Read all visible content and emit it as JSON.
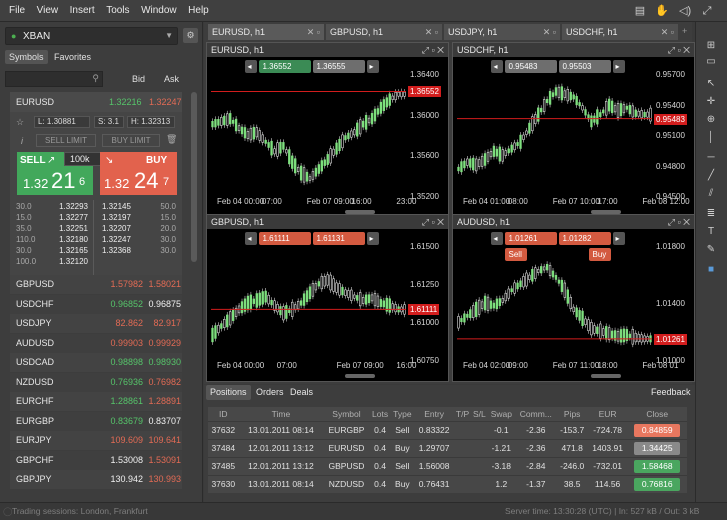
{
  "menu": [
    "File",
    "View",
    "Insert",
    "Tools",
    "Window",
    "Help"
  ],
  "account": {
    "name": "XBAN"
  },
  "symbols_tabs": [
    "Symbols",
    "Favorites"
  ],
  "headers": {
    "bid": "Bid",
    "ask": "Ask"
  },
  "eurusd": {
    "name": "EURUSD",
    "bid": "1.32216",
    "ask": "1.32247",
    "low": "L: 1.30881",
    "spread": "S: 3.1",
    "high": "H: 1.32313",
    "sell_limit": "SELL LIMIT",
    "buy_limit": "BUY LIMIT",
    "sell_label": "SELL",
    "buy_label": "BUY",
    "qty": "100k",
    "sell_small": "1.32",
    "sell_big": "21",
    "sell_pip": "6",
    "buy_small": "1.32",
    "buy_big": "24",
    "buy_pip": "7",
    "depth_left": [
      [
        "30.0",
        "1.32293"
      ],
      [
        "15.0",
        "1.32277"
      ],
      [
        "35.0",
        "1.32251"
      ],
      [
        "110.0",
        "1.32180"
      ],
      [
        "30.0",
        "1.32165"
      ],
      [
        "100.0",
        "1.32120"
      ]
    ],
    "depth_right": [
      [
        "1.32145",
        "50.0"
      ],
      [
        "1.32197",
        "15.0"
      ],
      [
        "1.32207",
        "20.0"
      ],
      [
        "1.32247",
        "30.0"
      ],
      [
        "1.32368",
        "30.0"
      ]
    ]
  },
  "symbols": [
    {
      "name": "GBPUSD",
      "bid": "1.57982",
      "ask": "1.58021",
      "bc": "red",
      "ac": "red"
    },
    {
      "name": "USDCHF",
      "bid": "0.96852",
      "ask": "0.96875",
      "bc": "green",
      "ac": "white"
    },
    {
      "name": "USDJPY",
      "bid": "82.862",
      "ask": "82.917",
      "bc": "red",
      "ac": "red"
    },
    {
      "name": "AUDUSD",
      "bid": "0.99903",
      "ask": "0.99929",
      "bc": "red",
      "ac": "red"
    },
    {
      "name": "USDCAD",
      "bid": "0.98898",
      "ask": "0.98930",
      "bc": "green",
      "ac": "green"
    },
    {
      "name": "NZDUSD",
      "bid": "0.76936",
      "ask": "0.76982",
      "bc": "green",
      "ac": "red"
    },
    {
      "name": "EURCHF",
      "bid": "1.28861",
      "ask": "1.28891",
      "bc": "green",
      "ac": "red"
    },
    {
      "name": "EURGBP",
      "bid": "0.83679",
      "ask": "0.83707",
      "bc": "green",
      "ac": "white"
    },
    {
      "name": "EURJPY",
      "bid": "109.609",
      "ask": "109.641",
      "bc": "red",
      "ac": "red"
    },
    {
      "name": "GBPCHF",
      "bid": "1.53008",
      "ask": "1.53091",
      "bc": "white",
      "ac": "red"
    },
    {
      "name": "GBPJPY",
      "bid": "130.942",
      "ask": "130.993",
      "bc": "white",
      "ac": "red"
    }
  ],
  "chart_tabs": [
    "EURUSD, h1",
    "GBPUSD, h1",
    "USDJPY, h1",
    "USDCHF, h1"
  ],
  "charts": [
    {
      "title": "EURUSD, h1",
      "sell": "1.36552",
      "buy": "1.36555",
      "last": "1.36552",
      "ticks": [
        "1.36400",
        "1.36000",
        "1.35600",
        "1.35200"
      ],
      "times": [
        "Feb 04 00:00",
        "07:00",
        "Feb 07 09:00",
        "16:00",
        "23:00"
      ]
    },
    {
      "title": "USDCHF, h1",
      "sell": "0.95483",
      "buy": "0.95503",
      "last": "0.95483",
      "ticks": [
        "0.95700",
        "0.95400",
        "0.95100",
        "0.94800",
        "0.94500"
      ],
      "times": [
        "Feb 04 01:00",
        "08:00",
        "Feb 07 10:00",
        "17:00",
        "Feb 08 12:00"
      ]
    },
    {
      "title": "GBPUSD, h1",
      "sell": "1.61111",
      "buy": "1.61131",
      "last": "1.61111",
      "ticks": [
        "1.61500",
        "1.61250",
        "1.61000",
        "1.60750"
      ],
      "times": [
        "Feb 04 00:00",
        "07:00",
        "Feb 07 09:00",
        "16:00"
      ]
    },
    {
      "title": "AUDUSD, h1",
      "sell": "1.01261",
      "buy": "1.01282",
      "last": "1.01261",
      "sell_lbl": "Sell",
      "buy_lbl": "Buy",
      "ticks": [
        "1.01800",
        "1.01400",
        "1.01000"
      ],
      "times": [
        "Feb 04 02:00",
        "09:00",
        "Feb 07 11:00",
        "18:00",
        "Feb 08 01"
      ]
    }
  ],
  "bottom_tabs": [
    "Positions",
    "Orders",
    "Deals"
  ],
  "feedback": "Feedback",
  "positions": {
    "columns": [
      "ID",
      "Time",
      "Symbol",
      "Lots",
      "Type",
      "Entry",
      "T/P",
      "S/L",
      "Swap",
      "Comm...",
      "Pips",
      "EUR",
      "Close"
    ],
    "rows": [
      [
        "37632",
        "13.01.2011 08:14",
        "EURGBP",
        "0.4",
        "Sell",
        "0.83322",
        "",
        "",
        "-0.1",
        "-2.36",
        "-153.7",
        "-724.78",
        "0.84859"
      ],
      [
        "37484",
        "12.01.2011 13:12",
        "EURUSD",
        "0.4",
        "Buy",
        "1.29707",
        "",
        "",
        "-1.21",
        "-2.36",
        "471.8",
        "1403.91",
        "1.34425"
      ],
      [
        "37485",
        "12.01.2011 13:12",
        "GBPUSD",
        "0.4",
        "Sell",
        "1.56008",
        "",
        "",
        "-3.18",
        "-2.84",
        "-246.0",
        "-732.01",
        "1.58468"
      ],
      [
        "37630",
        "13.01.2011 08:14",
        "NZDUSD",
        "0.4",
        "Buy",
        "0.76431",
        "",
        "",
        "1.2",
        "-1.37",
        "38.5",
        "114.56",
        "0.76816"
      ]
    ],
    "close_colors": [
      "#e8775f",
      "#8a8a8a",
      "#4aa65f",
      "#4aa65f"
    ]
  },
  "status": {
    "left": "Trading sessions: London, Frankfurt",
    "right": "Server time: 13:30:28 (UTC)  |  In: 527 kB / Out: 3 kB"
  }
}
